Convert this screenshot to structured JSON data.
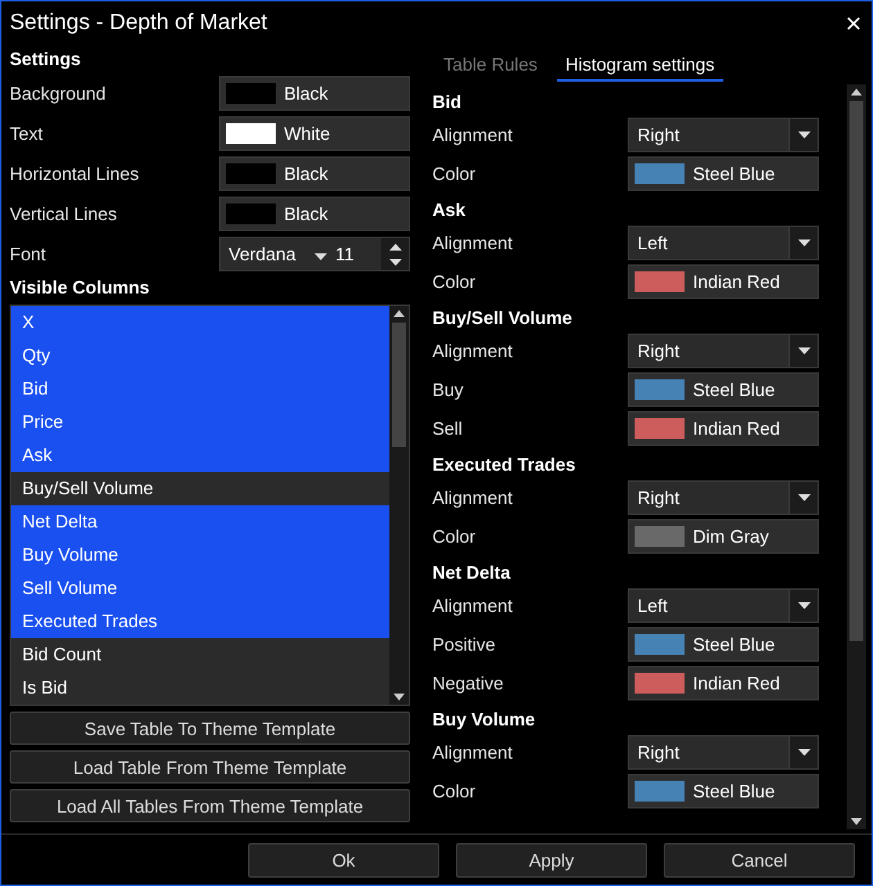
{
  "window": {
    "title": "Settings - Depth of Market"
  },
  "settings": {
    "heading": "Settings",
    "rows": [
      {
        "kind": "color",
        "label": "Background",
        "value": "Black",
        "color": "#000000"
      },
      {
        "kind": "color",
        "label": "Text",
        "value": "White",
        "color": "#ffffff"
      },
      {
        "kind": "color",
        "label": "Horizontal Lines",
        "value": "Black",
        "color": "#000000"
      },
      {
        "kind": "color",
        "label": "Vertical Lines",
        "value": "Black",
        "color": "#000000"
      },
      {
        "kind": "font",
        "label": "Font",
        "value": "Verdana",
        "size": "11"
      }
    ]
  },
  "visible_columns": {
    "heading": "Visible Columns",
    "items": [
      {
        "label": "X",
        "selected": true
      },
      {
        "label": "Qty",
        "selected": true
      },
      {
        "label": "Bid",
        "selected": true
      },
      {
        "label": "Price",
        "selected": true
      },
      {
        "label": "Ask",
        "selected": true
      },
      {
        "label": "Buy/Sell Volume",
        "selected": false
      },
      {
        "label": "Net Delta",
        "selected": true
      },
      {
        "label": "Buy Volume",
        "selected": true
      },
      {
        "label": "Sell Volume",
        "selected": true
      },
      {
        "label": "Executed Trades",
        "selected": true
      },
      {
        "label": "Bid Count",
        "selected": false
      },
      {
        "label": "Is Bid",
        "selected": false
      }
    ]
  },
  "template_buttons": [
    "Save Table To Theme Template",
    "Load Table From Theme Template",
    "Load All Tables From Theme Template"
  ],
  "tabs": [
    {
      "label": "Table Rules",
      "selected": false
    },
    {
      "label": "Histogram settings",
      "selected": true
    }
  ],
  "histogram": [
    {
      "title": "Bid",
      "rows": [
        {
          "kind": "dropdown",
          "label": "Alignment",
          "value": "Right"
        },
        {
          "kind": "color",
          "label": "Color",
          "value": "Steel Blue",
          "color": "#4682b4"
        }
      ]
    },
    {
      "title": "Ask",
      "rows": [
        {
          "kind": "dropdown",
          "label": "Alignment",
          "value": "Left"
        },
        {
          "kind": "color",
          "label": "Color",
          "value": "Indian Red",
          "color": "#cd5c5c"
        }
      ]
    },
    {
      "title": "Buy/Sell Volume",
      "rows": [
        {
          "kind": "dropdown",
          "label": "Alignment",
          "value": "Right"
        },
        {
          "kind": "color",
          "label": "Buy",
          "value": "Steel Blue",
          "color": "#4682b4"
        },
        {
          "kind": "color",
          "label": "Sell",
          "value": "Indian Red",
          "color": "#cd5c5c"
        }
      ]
    },
    {
      "title": "Executed Trades",
      "rows": [
        {
          "kind": "dropdown",
          "label": "Alignment",
          "value": "Right"
        },
        {
          "kind": "color",
          "label": "Color",
          "value": "Dim Gray",
          "color": "#696969"
        }
      ]
    },
    {
      "title": "Net Delta",
      "rows": [
        {
          "kind": "dropdown",
          "label": "Alignment",
          "value": "Left"
        },
        {
          "kind": "color",
          "label": "Positive",
          "value": "Steel Blue",
          "color": "#4682b4"
        },
        {
          "kind": "color",
          "label": "Negative",
          "value": "Indian Red",
          "color": "#cd5c5c"
        }
      ]
    },
    {
      "title": "Buy Volume",
      "rows": [
        {
          "kind": "dropdown",
          "label": "Alignment",
          "value": "Right"
        },
        {
          "kind": "color",
          "label": "Color",
          "value": "Steel Blue",
          "color": "#4682b4"
        }
      ]
    }
  ],
  "footer_buttons": [
    "Ok",
    "Apply",
    "Cancel"
  ]
}
